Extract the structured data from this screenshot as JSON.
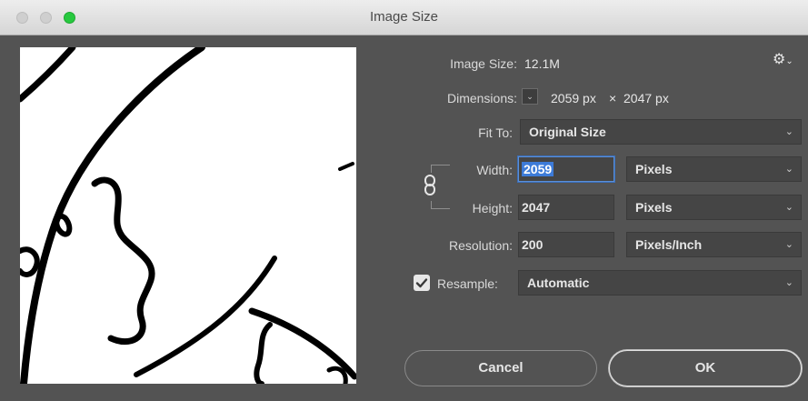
{
  "window": {
    "title": "Image Size"
  },
  "image_size": {
    "label": "Image Size:",
    "value": "12.1M"
  },
  "dimensions": {
    "label": "Dimensions:",
    "width_value": "2059 px",
    "separator": "×",
    "height_value": "2047 px"
  },
  "fit_to": {
    "label": "Fit To:",
    "selected": "Original Size"
  },
  "width": {
    "label": "Width:",
    "value": "2059",
    "unit": "Pixels"
  },
  "height": {
    "label": "Height:",
    "value": "2047",
    "unit": "Pixels"
  },
  "resolution": {
    "label": "Resolution:",
    "value": "200",
    "unit": "Pixels/Inch"
  },
  "resample": {
    "label": "Resample:",
    "checked": true,
    "selected": "Automatic"
  },
  "buttons": {
    "cancel": "Cancel",
    "ok": "OK"
  },
  "icons": {
    "settings": "gear-icon",
    "chain": "chain-link-icon",
    "dropdown": "chevron-down-icon",
    "check": "checkmark-icon"
  },
  "colors": {
    "panel": "#535353",
    "zoom_button": "#27c93f",
    "selection": "#3d7bd8"
  }
}
